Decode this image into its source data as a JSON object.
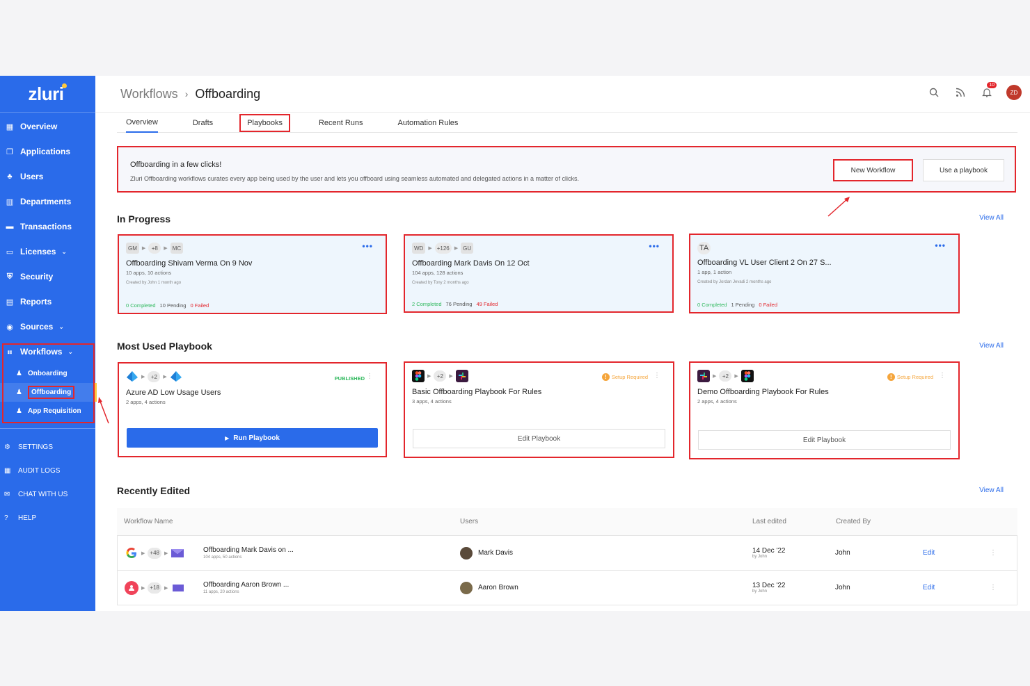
{
  "sidebar": {
    "logo": "zluri",
    "items": [
      {
        "label": "Overview",
        "icon": "grid-icon"
      },
      {
        "label": "Applications",
        "icon": "window-icon"
      },
      {
        "label": "Users",
        "icon": "users-icon"
      },
      {
        "label": "Departments",
        "icon": "building-icon"
      },
      {
        "label": "Transactions",
        "icon": "card-icon"
      },
      {
        "label": "Licenses",
        "icon": "license-icon"
      },
      {
        "label": "Security",
        "icon": "shield-icon"
      },
      {
        "label": "Reports",
        "icon": "report-icon"
      },
      {
        "label": "Sources",
        "icon": "sources-icon"
      },
      {
        "label": "Workflows",
        "icon": "workflow-icon"
      }
    ],
    "workflow_sub": [
      {
        "label": "Onboarding"
      },
      {
        "label": "Offboarding"
      },
      {
        "label": "App Requisition"
      }
    ],
    "bottom": [
      {
        "label": "SETTINGS",
        "icon": "gear-icon"
      },
      {
        "label": "AUDIT LOGS",
        "icon": "log-icon"
      },
      {
        "label": "CHAT WITH US",
        "icon": "chat-icon"
      },
      {
        "label": "HELP",
        "icon": "help-icon"
      }
    ]
  },
  "header": {
    "crumb_parent": "Workflows",
    "crumb_sep": "›",
    "crumb_current": "Offboarding",
    "notification_count": "10",
    "avatar_initials": "ZD"
  },
  "tabs": [
    "Overview",
    "Drafts",
    "Playbooks",
    "Recent Runs",
    "Automation Rules"
  ],
  "banner": {
    "title": "Offboarding in a few clicks!",
    "text": "Zluri Offboarding workflows curates every app being used by the user and lets you offboard using seamless automated and delegated actions in a matter of clicks.",
    "new_workflow": "New Workflow",
    "use_playbook": "Use a playbook"
  },
  "in_progress": {
    "title": "In Progress",
    "view_all": "View All",
    "cards": [
      {
        "chips": [
          "GM",
          "+8",
          "MC"
        ],
        "title": "Offboarding Shivam Verma On 9 Nov",
        "sub": "10 apps, 10 actions",
        "by": "Created by John 1 month ago",
        "completed": "0 Completed",
        "pending": "10 Pending",
        "failed": "0 Failed"
      },
      {
        "chips": [
          "WD",
          "+126",
          "GU"
        ],
        "title": "Offboarding Mark Davis On 12 Oct",
        "sub": "104 apps, 128 actions",
        "by": "Created by Tony 2 months ago",
        "completed": "2 Completed",
        "pending": "76 Pending",
        "failed": "49 Failed"
      },
      {
        "chips": [
          "TA"
        ],
        "title": "Offboarding VL User Client 2 On 27 S...",
        "sub": "1 app, 1 action",
        "by": "Created by Jordan Jevadi 2 months ago",
        "completed": "0 Completed",
        "pending": "1 Pending",
        "failed": "0 Failed"
      }
    ]
  },
  "most_used": {
    "title": "Most Used Playbook",
    "view_all": "View All",
    "cards": [
      {
        "count": "+2",
        "title": "Azure AD Low Usage Users",
        "sub": "2 apps, 4 actions",
        "status": "PUBLISHED",
        "button": "Run Playbook"
      },
      {
        "count": "+2",
        "title": "Basic Offboarding Playbook For Rules",
        "sub": "3 apps, 4 actions",
        "status": "Setup Required",
        "button": "Edit Playbook"
      },
      {
        "count": "+2",
        "title": "Demo Offboarding Playbook For Rules",
        "sub": "2 apps, 4 actions",
        "status": "Setup Required",
        "button": "Edit Playbook"
      }
    ]
  },
  "recently_edited": {
    "title": "Recently Edited",
    "view_all": "View All",
    "headers": [
      "Workflow Name",
      "Users",
      "Last edited",
      "Created By"
    ],
    "rows": [
      {
        "count": "+48",
        "name": "Offboarding Mark Davis on ...",
        "sub": "104 apps, 50 actions",
        "user": "Mark Davis",
        "date": "14 Dec '22",
        "date_by": "by John",
        "created_by": "John",
        "action": "Edit"
      },
      {
        "count": "+18",
        "name": "Offboarding Aaron Brown ...",
        "sub": "11 apps, 20 actions",
        "user": "Aaron Brown",
        "date": "13 Dec '22",
        "date_by": "by John",
        "created_by": "John",
        "action": "Edit"
      }
    ]
  },
  "colors": {
    "brand": "#2a6bea",
    "highlight": "#e3262c",
    "success": "#2eb85c",
    "warning": "#f5a53b"
  }
}
